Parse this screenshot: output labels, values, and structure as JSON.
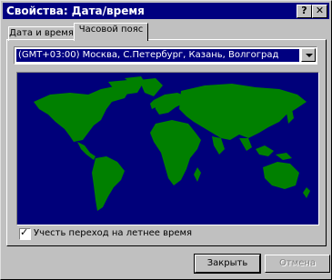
{
  "window": {
    "title": "Свойства: Дата/время"
  },
  "titlebar_buttons": {
    "help": "?",
    "close": "✕"
  },
  "tabs": [
    {
      "label": "Дата и время",
      "active": false
    },
    {
      "label": "Часовой пояс",
      "active": true
    }
  ],
  "timezone": {
    "selected": "(GMT+03:00) Москва, С.Петербург, Казань, Волгоград"
  },
  "map": {
    "ocean_color": "#00007a",
    "land_color": "#008000"
  },
  "dst": {
    "label": "Учесть переход на летнее время",
    "checked": true
  },
  "buttons": {
    "close": "Закрыть",
    "cancel": "Отмена"
  }
}
